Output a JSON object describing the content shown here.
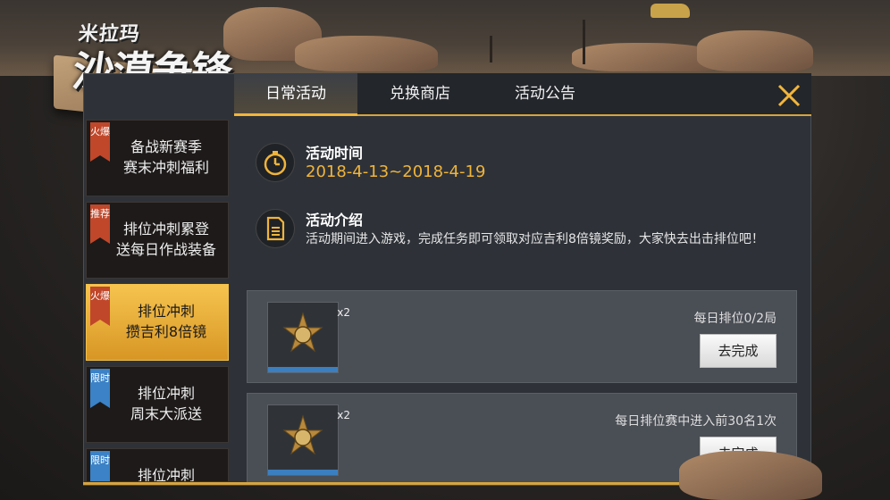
{
  "logo": {
    "line1": "米拉玛",
    "line2": "沙漠争锋"
  },
  "tabs": [
    {
      "label": "日常活动",
      "active": true
    },
    {
      "label": "兑换商店",
      "active": false
    },
    {
      "label": "活动公告",
      "active": false
    }
  ],
  "sidebar": {
    "items": [
      {
        "badge": "火爆",
        "badge_type": "hot",
        "line1": "备战新赛季",
        "line2": "赛末冲刺福利",
        "active": false
      },
      {
        "badge": "推荐",
        "badge_type": "hot",
        "line1": "排位冲刺累登",
        "line2": "送每日作战装备",
        "active": false
      },
      {
        "badge": "火爆",
        "badge_type": "hot",
        "line1": "排位冲刺",
        "line2": "攒吉利8倍镜",
        "active": true
      },
      {
        "badge": "限时",
        "badge_type": "limit",
        "line1": "排位冲刺",
        "line2": "周末大派送",
        "active": false
      },
      {
        "badge": "限时",
        "badge_type": "limit",
        "line1": "排位冲刺",
        "line2": "",
        "active": false
      }
    ]
  },
  "activity": {
    "time_title": "活动时间",
    "time_value": "2018-4-13~2018-4-19",
    "intro_title": "活动介绍",
    "intro_text": "活动期间进入游戏，完成任务即可领取对应吉利8倍镜奖励，大家快去出击排位吧！"
  },
  "tasks": [
    {
      "qty": "x2",
      "desc": "每日排位0/2局",
      "button": "去完成"
    },
    {
      "qty": "x2",
      "desc": "每日排位赛中进入前30名1次",
      "button": "去完成"
    }
  ],
  "colors": {
    "accent": "#f0b43a",
    "badge_hot": "#c0472a",
    "badge_limit": "#3b82c7"
  }
}
